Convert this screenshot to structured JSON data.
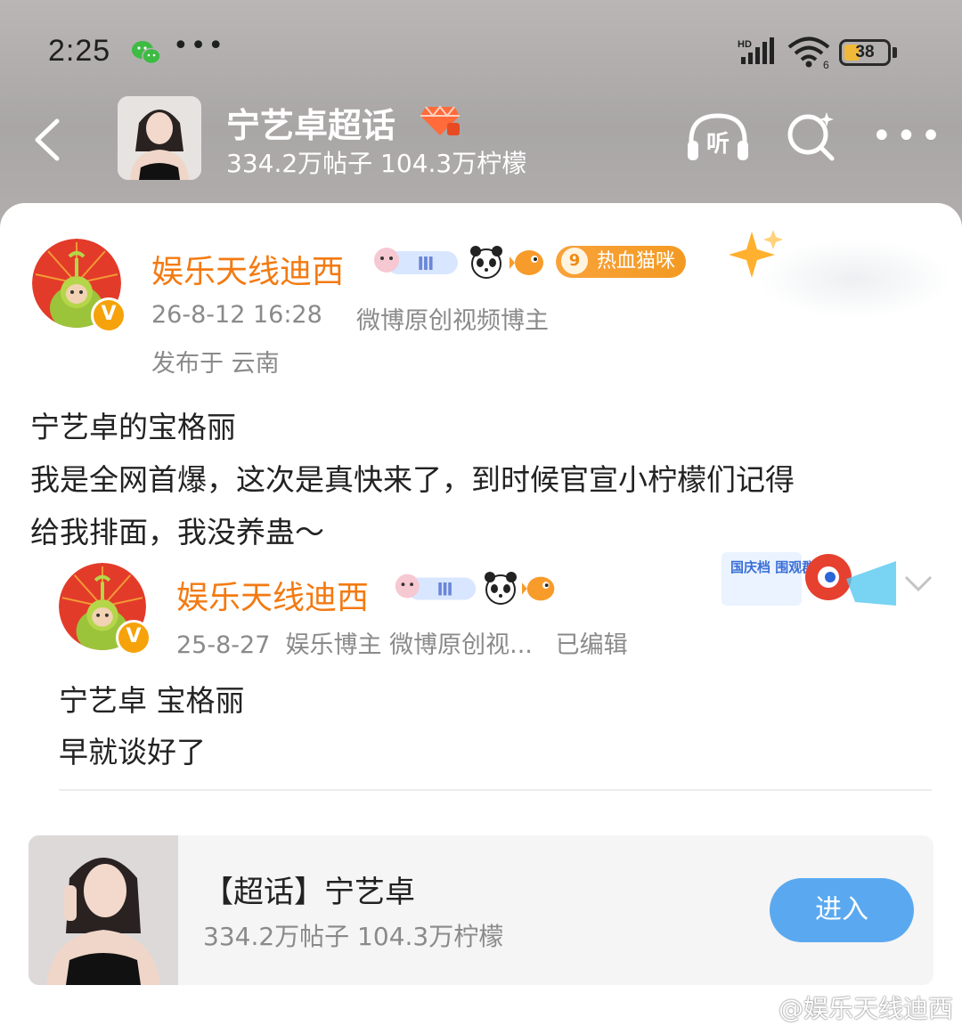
{
  "status_bar": {
    "time": "2:25",
    "dots": "•••",
    "signal_label": "HD",
    "wifi_label": "6",
    "battery": "38",
    "battery_level": 0.38
  },
  "topic": {
    "title": "宁艺卓超话",
    "stats": "334.2万帖子 104.3万柠檬"
  },
  "nav": {
    "listen_label": "听",
    "more": "•••"
  },
  "post": {
    "username": "娱乐天线迪西",
    "badge_level": "Ⅲ",
    "level_badge_num": "9",
    "level_badge_text": "热血猫咪",
    "time": "26-8-12 16:28",
    "source": "微博原创视频博主",
    "location": "发布于 云南",
    "lines": [
      "宁艺卓的宝格丽",
      "我是全网首爆，这次是真快来了，到时候官宣小柠檬们记得",
      "给我排面，我没养蛊～"
    ]
  },
  "repost": {
    "username": "娱乐天线迪西",
    "badge_level": "Ⅲ",
    "meta": "25-8-27  娱乐博主 微博原创视...   已编辑",
    "promo": "国庆档 围观群众",
    "lines": [
      "宁艺卓 宝格丽",
      "早就谈好了"
    ]
  },
  "link_card": {
    "title": "【超话】宁艺卓",
    "stats": "334.2万帖子 104.3万柠檬",
    "button": "进入"
  },
  "watermark": "@娱乐天线迪西",
  "colors": {
    "accent": "#f37a12",
    "button": "#5aa9f0",
    "vbadge": "#f6a20a"
  }
}
